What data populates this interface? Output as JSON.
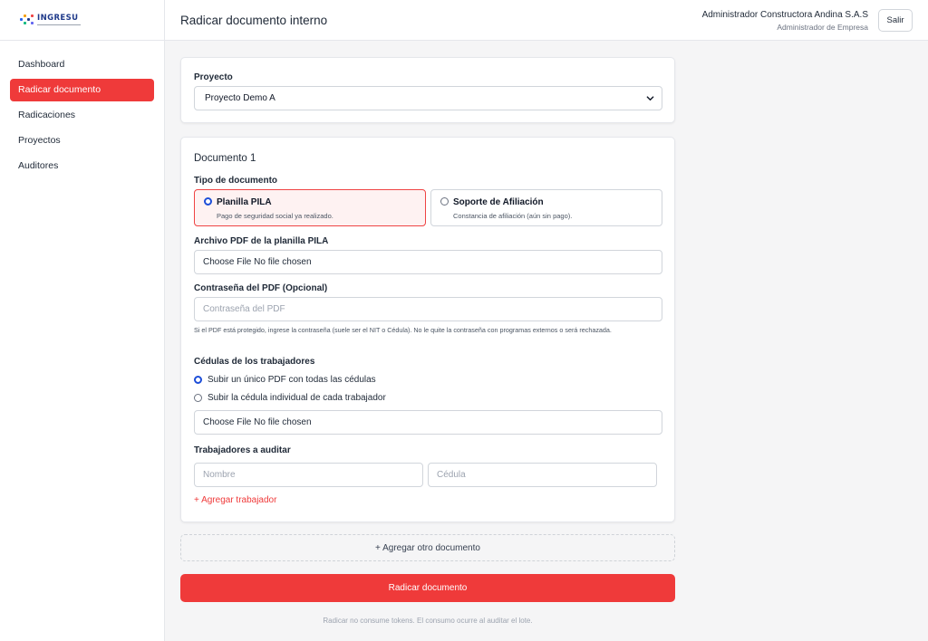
{
  "brand": {
    "name": "INGRESU",
    "logo_icon": "ingresu-logo-icon"
  },
  "sidebar": {
    "items": [
      {
        "label": "Dashboard",
        "active": false
      },
      {
        "label": "Radicar documento",
        "active": true
      },
      {
        "label": "Radicaciones",
        "active": false
      },
      {
        "label": "Proyectos",
        "active": false
      },
      {
        "label": "Auditores",
        "active": false
      }
    ]
  },
  "header": {
    "title": "Radicar documento interno",
    "user_name": "Administrador Constructora Andina S.A.S",
    "user_role": "Administrador de Empresa",
    "logout_label": "Salir"
  },
  "project": {
    "label": "Proyecto",
    "selected": "Proyecto Demo A"
  },
  "document": {
    "title": "Documento 1",
    "type_label": "Tipo de documento",
    "types": [
      {
        "title": "Planilla PILA",
        "desc": "Pago de seguridad social ya realizado.",
        "selected": true
      },
      {
        "title": "Soporte de Afiliación",
        "desc": "Constancia de afiliación (aún sin pago).",
        "selected": false
      }
    ],
    "pdf_label": "Archivo PDF de la planilla PILA",
    "pdf_file_text": "Choose File No file chosen",
    "password_label": "Contraseña del PDF (Opcional)",
    "password_placeholder": "Contraseña del PDF",
    "password_help": "Si el PDF está protegido, ingrese la contraseña (suele ser el NIT o Cédula). No le quite la contraseña con programas externos o será rechazada.",
    "cedulas_label": "Cédulas de los trabajadores",
    "cedulas_options": [
      {
        "label": "Subir un único PDF con todas las cédulas",
        "selected": true
      },
      {
        "label": "Subir la cédula individual de cada trabajador",
        "selected": false
      }
    ],
    "cedulas_file_text": "Choose File No file chosen",
    "workers_label": "Trabajadores a auditar",
    "worker_name_placeholder": "Nombre",
    "worker_id_placeholder": "Cédula",
    "add_worker_label": "+ Agregar trabajador"
  },
  "add_document_label": "+ Agregar otro documento",
  "submit_label": "Radicar documento",
  "footer_note": "Radicar no consume tokens. El consumo ocurre al auditar el lote.",
  "colors": {
    "accent": "#ef3a3a",
    "radio_on": "#1d4ed8",
    "brand": "#1f3a8a"
  }
}
